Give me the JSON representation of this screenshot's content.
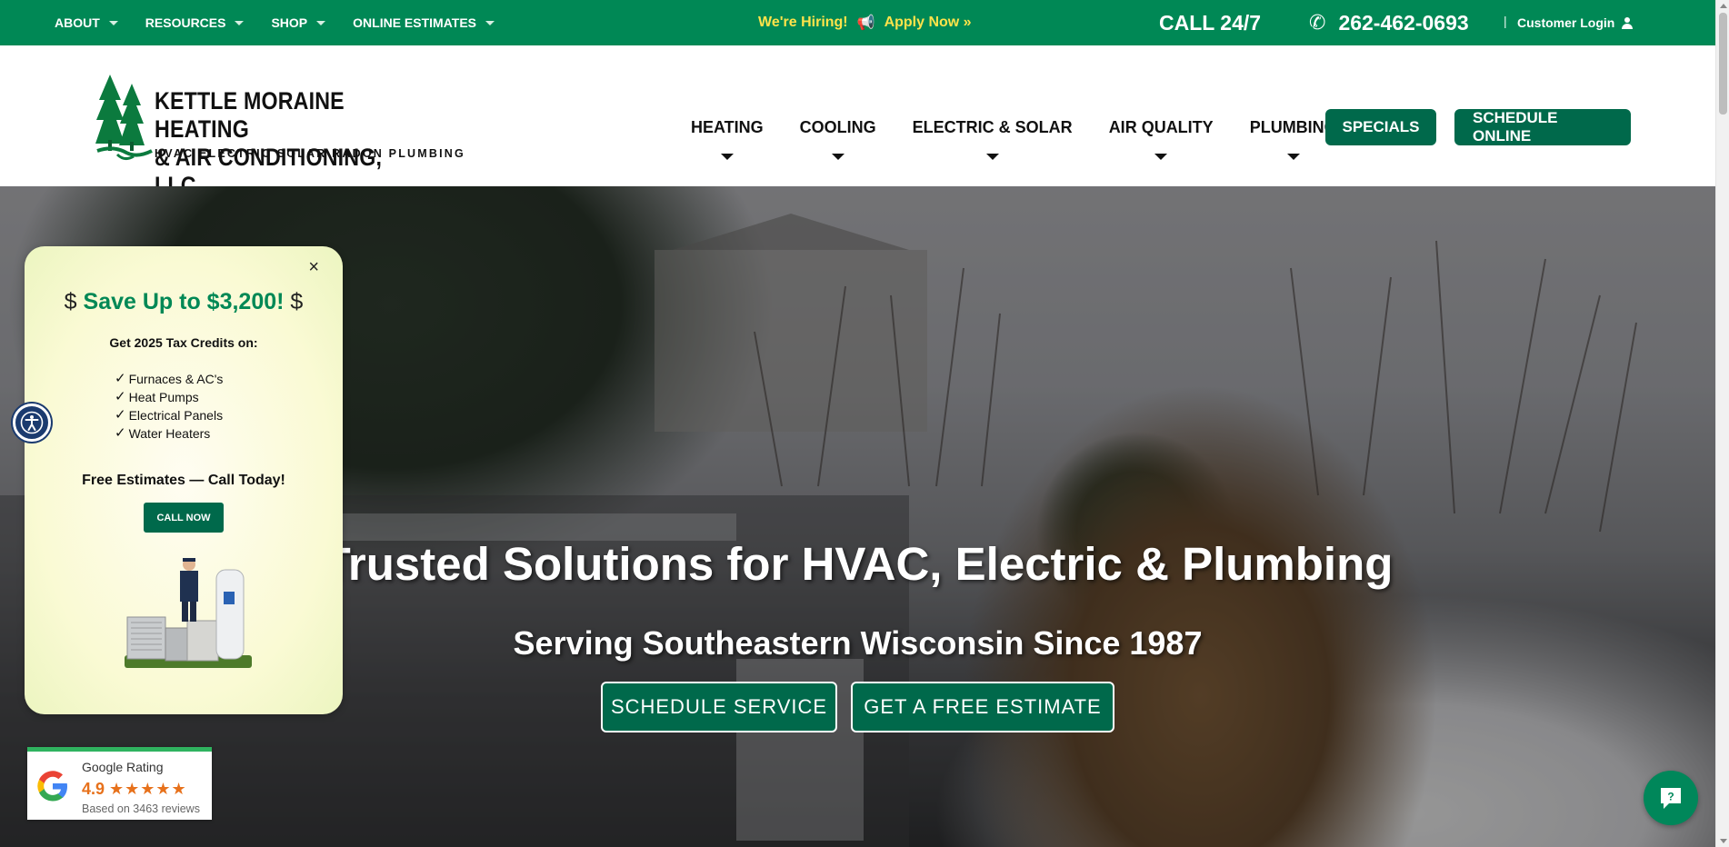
{
  "topbar": {
    "nav": [
      {
        "label": "ABOUT"
      },
      {
        "label": "RESOURCES"
      },
      {
        "label": "SHOP"
      },
      {
        "label": "ONLINE ESTIMATES"
      }
    ],
    "hiring_text": "We're Hiring!",
    "apply_text": "Apply Now »",
    "call_text": "CALL 24/7",
    "phone": "262-462-0693",
    "separator": "|",
    "login": "Customer Login",
    "colors": {
      "bar": "#008855",
      "hiring": "#ffe34a"
    }
  },
  "header": {
    "logo": {
      "name_line1": "KETTLE MORAINE HEATING",
      "name_line2": "& AIR CONDITIONING, LLC",
      "tagline": "HVAC ELECTRIC SOLAR RADON PLUMBING"
    },
    "nav": [
      {
        "label": "HEATING"
      },
      {
        "label": "COOLING"
      },
      {
        "label": "ELECTRIC & SOLAR"
      },
      {
        "label": "AIR QUALITY"
      },
      {
        "label": "PLUMBING"
      }
    ],
    "specials_label": "SPECIALS",
    "schedule_label": "SCHEDULE ONLINE",
    "accent": "#00694b"
  },
  "hero": {
    "title": "Trusted Solutions for HVAC, Electric & Plumbing",
    "subtitle": "Serving Southeastern Wisconsin Since 1987",
    "buttons": {
      "schedule_service": "SCHEDULE SERVICE",
      "free_estimate": "GET A FREE ESTIMATE"
    }
  },
  "promo": {
    "dollar_left": "$",
    "headline": "Save Up to $3,200!",
    "dollar_right": "$",
    "credits_heading": "Get 2025 Tax Credits on:",
    "items": [
      {
        "label": "Furnaces & AC's"
      },
      {
        "label": "Heat Pumps"
      },
      {
        "label": "Electrical Panels"
      },
      {
        "label": "Water Heaters"
      }
    ],
    "estimate_text": "Free Estimates — Call Today!",
    "call_button": "CALL NOW",
    "close_glyph": "×"
  },
  "google_rating": {
    "title": "Google Rating",
    "score": "4.9",
    "stars": "★★★★★",
    "rating_fraction": 0.98,
    "based_on": "Based on 3463 reviews"
  },
  "icons": {
    "caret": "caret-down-icon",
    "megaphone": "megaphone-icon",
    "phone": "phone-icon",
    "user": "user-icon",
    "check": "check-icon",
    "close": "close-icon",
    "accessibility": "accessibility-icon",
    "chat": "chat-icon",
    "google": "google-logo-icon"
  },
  "glyphs": {
    "megaphone": "📢",
    "phone": "✆",
    "check": "✓"
  }
}
